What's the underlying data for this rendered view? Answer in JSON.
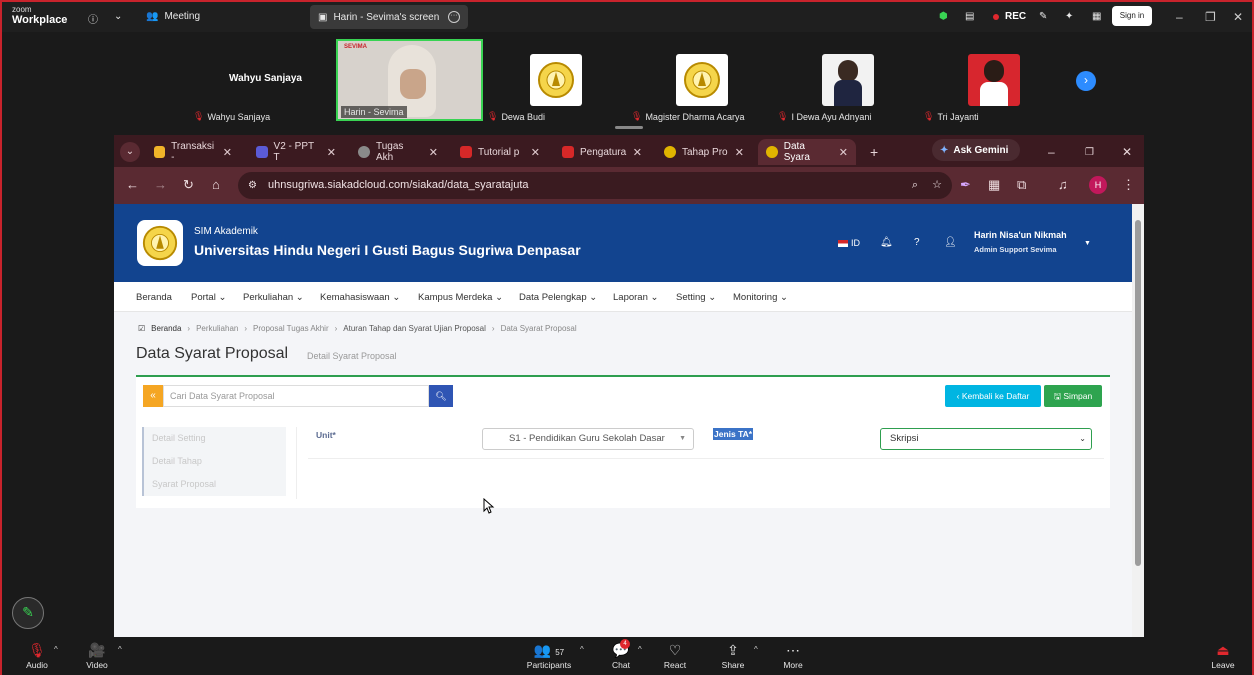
{
  "zoom_top": {
    "brand_line1": "zoom",
    "brand_line2": "Workplace",
    "meeting_label": "Meeting",
    "screen_share_label": "Harin - Sevima's screen",
    "rec_label": "REC",
    "sign_in_label": "Sign in"
  },
  "participants": [
    {
      "name": "Wahyu Sanjaya",
      "display": "Wahyu Sanjaya"
    },
    {
      "name": "Harin - Sevima"
    },
    {
      "name": "Dewa Budi"
    },
    {
      "name": "Magister Dharma Acarya"
    },
    {
      "name": "I Dewa Ayu Adnyani"
    },
    {
      "name": "Tri Jayanti"
    }
  ],
  "browser": {
    "tabs": [
      {
        "label": "Transaksi -",
        "color": "#f0b429"
      },
      {
        "label": "V2 - PPT T",
        "color": "#5b5bd6"
      },
      {
        "label": "Tugas Akh",
        "color": "#8a8a8a"
      },
      {
        "label": "Tutorial p",
        "color": "#d62828"
      },
      {
        "label": "Pengatura",
        "color": "#d62828"
      },
      {
        "label": "Tahap Pro",
        "color": "#e0b400"
      },
      {
        "label": "Data Syara",
        "color": "#e0b400"
      }
    ],
    "ask_gemini": "Ask Gemini",
    "url": "uhnsugriwa.siakadcloud.com/siakad/data_syaratajuta",
    "profile_initial": "H"
  },
  "app": {
    "sub": "SIM Akademik",
    "title": "Universitas Hindu Negeri I Gusti Bagus Sugriwa Denpasar",
    "lang": "ID",
    "user_name": "Harin Nisa'un Nikmah",
    "user_role": "Admin Support Sevima",
    "menu": [
      "Beranda",
      "Portal",
      "Perkuliahan",
      "Kemahasiswaan",
      "Kampus Merdeka",
      "Data Pelengkap",
      "Laporan",
      "Setting",
      "Monitoring"
    ],
    "breadcrumb": [
      "Beranda",
      "Perkuliahan",
      "Proposal Tugas Akhir",
      "Aturan Tahap dan Syarat Ujian Proposal",
      "Data Syarat Proposal"
    ],
    "page_title": "Data Syarat Proposal",
    "page_subtitle": "Detail Syarat Proposal",
    "search_placeholder": "Cari Data Syarat Proposal",
    "back_label": "Kembali ke Daftar",
    "save_label": "Simpan",
    "side_menu": [
      "Detail Setting",
      "Detail Tahap",
      "Syarat Proposal"
    ],
    "unit_label": "Unit*",
    "unit_value": "S1 - Pendidikan Guru Sekolah Dasar",
    "jenis_label": "Jenis TA*",
    "jenis_value": "Skripsi"
  },
  "zoom_bottom": {
    "audio": "Audio",
    "video": "Video",
    "participants": "Participants",
    "participant_count": "57",
    "chat": "Chat",
    "chat_badge": "4",
    "react": "React",
    "share": "Share",
    "more": "More",
    "leave": "Leave"
  }
}
